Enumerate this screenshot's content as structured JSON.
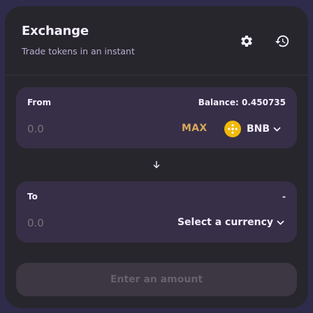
{
  "header": {
    "title": "Exchange",
    "subtitle": "Trade tokens in an instant",
    "settings_icon": "gear-icon",
    "history_icon": "history-icon"
  },
  "from": {
    "label": "From",
    "balance": "Balance: 0.450735",
    "placeholder": "0.0",
    "max_label": "MAX",
    "token_symbol": "BNB",
    "token_icon": "bnb-logo-icon"
  },
  "swap_icon": "arrow-down-icon",
  "to": {
    "label": "To",
    "balance": "-",
    "placeholder": "0.0",
    "select_label": "Select a currency"
  },
  "submit": {
    "label": "Enter an amount"
  },
  "colors": {
    "background": "#2f2b4a",
    "card": "#27262c",
    "panel": "#372f47",
    "text": "#f4eeff",
    "muted": "#8f80ba",
    "accent": "#d6a85c",
    "bnb": "#f0b90b",
    "button_disabled": "#3c3742"
  }
}
